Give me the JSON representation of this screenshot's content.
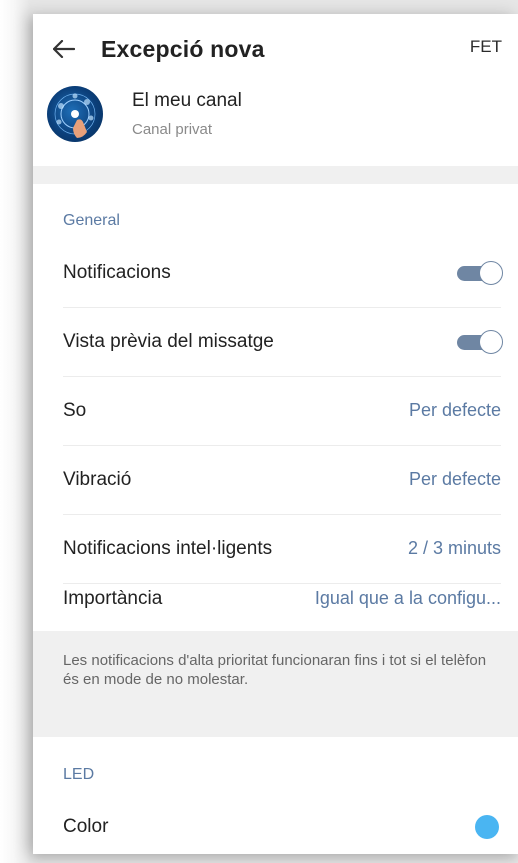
{
  "header": {
    "title": "Excepció nova",
    "done_label": "FET"
  },
  "channel": {
    "name": "El meu canal",
    "subtitle": "Canal privat"
  },
  "general": {
    "title": "General",
    "notifications_label": "Notificacions",
    "notifications_on": true,
    "preview_label": "Vista prèvia del missatge",
    "preview_on": true,
    "sound_label": "So",
    "sound_value": "Per defecte",
    "vibration_label": "Vibració",
    "vibration_value": "Per defecte",
    "smart_label": "Notificacions intel·ligents",
    "smart_value": "2 / 3 minuts",
    "importance_label": "Importància",
    "importance_value": "Igual que a la configu..."
  },
  "note": "Les notificacions d'alta prioritat funcionaran fins i tot si el telèfon és en mode de no molestar.",
  "led": {
    "title": "LED",
    "color_label": "Color",
    "color_value": "#4ab5f2"
  },
  "colors": {
    "accent": "#5b7aa3",
    "toggle": "#6f86a3"
  }
}
